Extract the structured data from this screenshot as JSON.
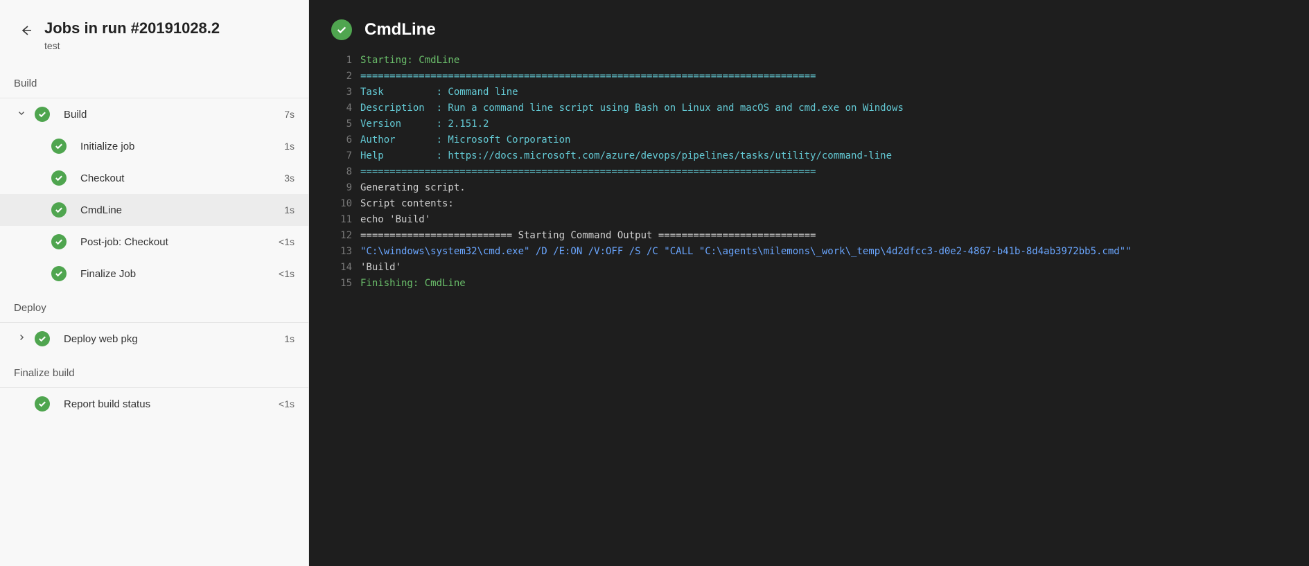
{
  "header": {
    "title": "Jobs in run #20191028.2",
    "subtitle": "test"
  },
  "stages": [
    {
      "label": "Build",
      "jobs": [
        {
          "label": "Build",
          "expanded": true,
          "duration": "7s",
          "steps": [
            {
              "label": "Initialize job",
              "duration": "1s",
              "selected": false
            },
            {
              "label": "Checkout",
              "duration": "3s",
              "selected": false
            },
            {
              "label": "CmdLine",
              "duration": "1s",
              "selected": true
            },
            {
              "label": "Post-job: Checkout",
              "duration": "<1s",
              "selected": false
            },
            {
              "label": "Finalize Job",
              "duration": "<1s",
              "selected": false
            }
          ]
        }
      ]
    },
    {
      "label": "Deploy",
      "jobs": [
        {
          "label": "Deploy web pkg",
          "expanded": false,
          "duration": "1s",
          "steps": []
        }
      ]
    },
    {
      "label": "Finalize build",
      "jobs": [
        {
          "label": "Report build status",
          "expanded": false,
          "duration": "<1s",
          "steps": [],
          "noChevron": true
        }
      ]
    }
  ],
  "main": {
    "title": "CmdLine",
    "log": [
      {
        "n": 1,
        "tokens": [
          {
            "c": "green",
            "t": "Starting: CmdLine"
          }
        ]
      },
      {
        "n": 2,
        "tokens": [
          {
            "c": "cyan",
            "t": "=============================================================================="
          }
        ]
      },
      {
        "n": 3,
        "tokens": [
          {
            "c": "cyan",
            "t": "Task         : Command line"
          }
        ]
      },
      {
        "n": 4,
        "tokens": [
          {
            "c": "cyan",
            "t": "Description  : Run a command line script using Bash on Linux and macOS and cmd.exe on Windows"
          }
        ]
      },
      {
        "n": 5,
        "tokens": [
          {
            "c": "cyan",
            "t": "Version      : 2.151.2"
          }
        ]
      },
      {
        "n": 6,
        "tokens": [
          {
            "c": "cyan",
            "t": "Author       : Microsoft Corporation"
          }
        ]
      },
      {
        "n": 7,
        "tokens": [
          {
            "c": "cyan",
            "t": "Help         : https://docs.microsoft.com/azure/devops/pipelines/tasks/utility/command-line"
          }
        ]
      },
      {
        "n": 8,
        "tokens": [
          {
            "c": "cyan",
            "t": "=============================================================================="
          }
        ]
      },
      {
        "n": 9,
        "tokens": [
          {
            "c": "plain",
            "t": "Generating script."
          }
        ]
      },
      {
        "n": 10,
        "tokens": [
          {
            "c": "plain",
            "t": "Script contents:"
          }
        ]
      },
      {
        "n": 11,
        "tokens": [
          {
            "c": "plain",
            "t": "echo 'Build'"
          }
        ]
      },
      {
        "n": 12,
        "tokens": [
          {
            "c": "plain",
            "t": "========================== Starting Command Output ==========================="
          }
        ]
      },
      {
        "n": 13,
        "tokens": [
          {
            "c": "blue",
            "t": "\"C:\\windows\\system32\\cmd.exe\" /D /E:ON /V:OFF /S /C \"CALL \"C:\\agents\\milemons\\_work\\_temp\\4d2dfcc3-d0e2-4867-b41b-8d4ab3972bb5.cmd\"\""
          }
        ]
      },
      {
        "n": 14,
        "tokens": [
          {
            "c": "plain",
            "t": "'Build'"
          }
        ]
      },
      {
        "n": 15,
        "tokens": [
          {
            "c": "green",
            "t": "Finishing: CmdLine"
          }
        ]
      }
    ]
  }
}
